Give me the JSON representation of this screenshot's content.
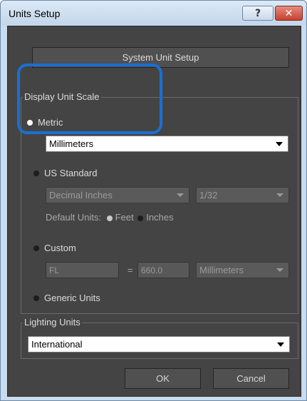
{
  "window": {
    "title": "Units Setup",
    "help_glyph": "?",
    "close_glyph": "✕"
  },
  "system_unit_setup_label": "System Unit Setup",
  "display_unit_scale": {
    "group_label": "Display Unit Scale",
    "metric_label": "Metric",
    "metric_value": "Millimeters",
    "us_standard_label": "US Standard",
    "us_units_value": "Decimal Inches",
    "us_fraction_value": "1/32",
    "default_units_label": "Default Units:",
    "feet_label": "Feet",
    "inches_label": "Inches",
    "custom_label": "Custom",
    "custom_name_value": "FL",
    "equals_sign": "=",
    "custom_amount_value": "660.0",
    "custom_unit_value": "Millimeters",
    "generic_units_label": "Generic Units",
    "selected": "Metric"
  },
  "lighting_units": {
    "group_label": "Lighting Units",
    "value": "International"
  },
  "buttons": {
    "ok_label": "OK",
    "cancel_label": "Cancel"
  },
  "colors": {
    "highlight": "#1a6fd4",
    "panel_bg": "#444444",
    "titlebar": "#c9dbee"
  }
}
